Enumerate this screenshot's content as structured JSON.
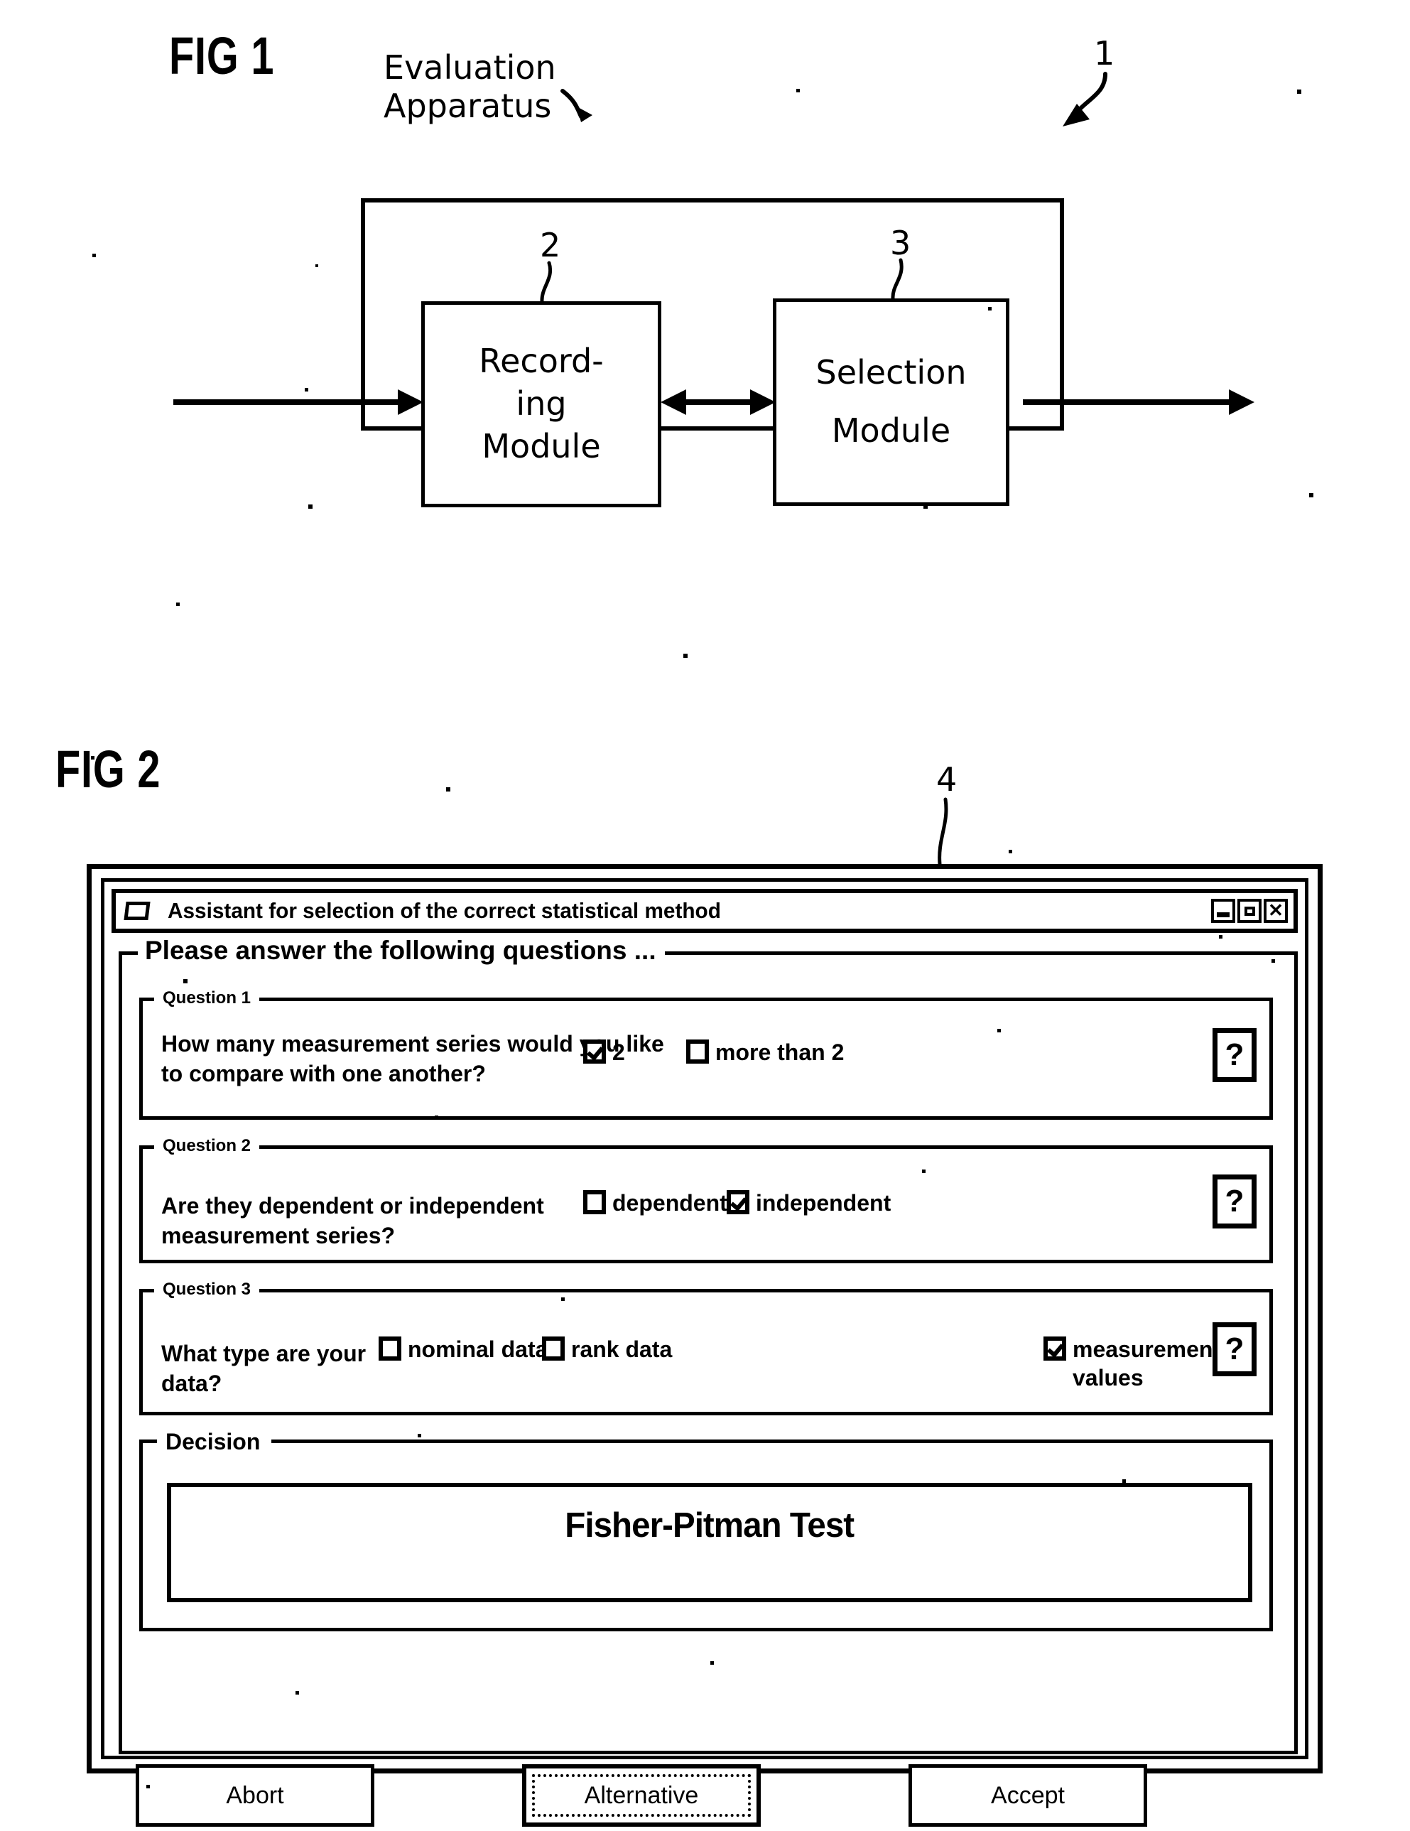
{
  "figures": [
    {
      "id": "fig1",
      "label": "FIG 1",
      "annotation": "Evaluation\nApparatus",
      "annotation_line1": "Evaluation",
      "annotation_line2": "Apparatus",
      "ref_outer": "1",
      "blocks": [
        {
          "ref": "2",
          "label_line1": "Record-",
          "label_line2": "ing",
          "label_line3": "Module",
          "name": "recording-module"
        },
        {
          "ref": "3",
          "label_line1": "Selection",
          "label_line2": "Module",
          "name": "selection-module"
        }
      ]
    },
    {
      "id": "fig2",
      "label": "FIG 2",
      "ref_window": "4"
    }
  ],
  "window": {
    "icon": "window-document-icon",
    "title": "Assistant for selection of the correct statistical method",
    "controls": [
      {
        "name": "minimize-button",
        "glyph": "minimize"
      },
      {
        "name": "maximize-button",
        "glyph": "maximize"
      },
      {
        "name": "close-button",
        "glyph": "✕"
      }
    ]
  },
  "main_group": {
    "legend": "Please answer the following questions ..."
  },
  "questions": [
    {
      "legend": "Question 1",
      "prompt": "How many measurement series would you like\nto compare with one another?",
      "options": [
        {
          "label": "2",
          "checked": true,
          "name": "option-two"
        },
        {
          "label": "more than 2",
          "checked": false,
          "name": "option-more-than-two"
        }
      ],
      "help": "?"
    },
    {
      "legend": "Question 2",
      "prompt": "Are they dependent or independent measurement series?",
      "options": [
        {
          "label": "dependent",
          "checked": false,
          "name": "option-dependent"
        },
        {
          "label": "independent",
          "checked": true,
          "name": "option-independent"
        }
      ],
      "help": "?"
    },
    {
      "legend": "Question 3",
      "prompt": "What type are your data?",
      "options": [
        {
          "label": "nominal data",
          "checked": false,
          "name": "option-nominal-data"
        },
        {
          "label": "rank data",
          "checked": false,
          "name": "option-rank-data"
        },
        {
          "label": "measurement\nvalues",
          "checked": true,
          "name": "option-measurement-values"
        }
      ],
      "help": "?"
    }
  ],
  "decision": {
    "legend": "Decision",
    "result": "Fisher-Pitman Test"
  },
  "buttons": [
    {
      "label": "Abort",
      "name": "abort-button",
      "focused": false
    },
    {
      "label": "Alternative",
      "name": "alternative-button",
      "focused": true
    },
    {
      "label": "Accept",
      "name": "accept-button",
      "focused": false
    }
  ],
  "colors": {
    "ink": "#000000",
    "paper": "#ffffff"
  }
}
